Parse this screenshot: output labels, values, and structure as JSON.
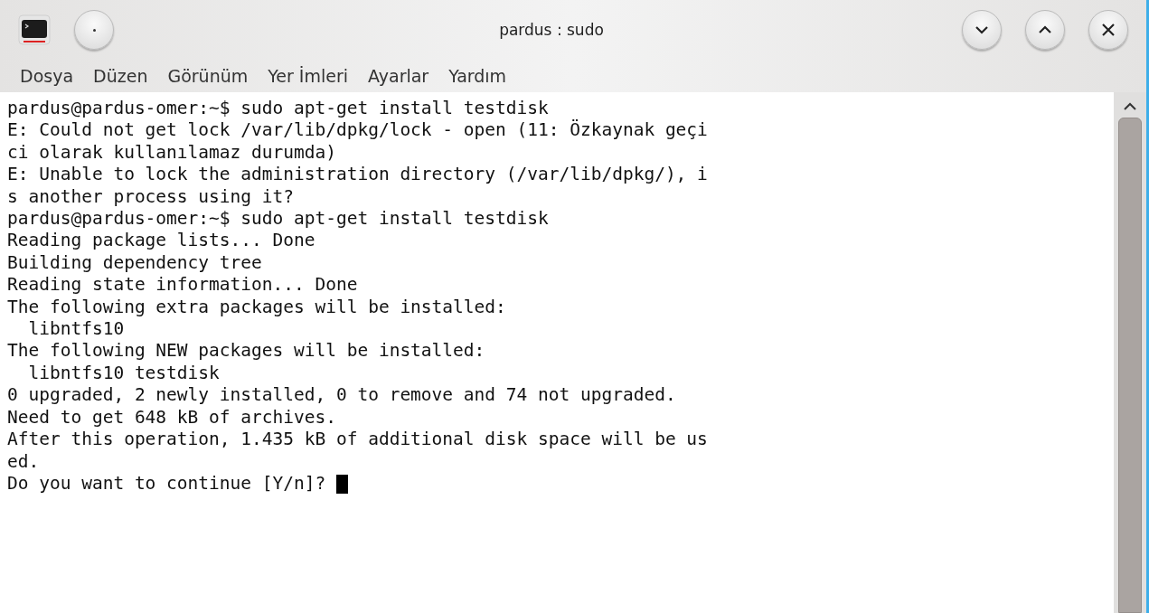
{
  "window": {
    "title": "pardus : sudo"
  },
  "menu": [
    "Dosya",
    "Düzen",
    "Görünüm",
    "Yer İmleri",
    "Ayarlar",
    "Yardım"
  ],
  "terminal": {
    "lines": [
      "pardus@pardus-omer:~$ sudo apt-get install testdisk",
      "E: Could not get lock /var/lib/dpkg/lock - open (11: Özkaynak geçi",
      "ci olarak kullanılamaz durumda)",
      "E: Unable to lock the administration directory (/var/lib/dpkg/), i",
      "s another process using it?",
      "pardus@pardus-omer:~$ sudo apt-get install testdisk",
      "Reading package lists... Done",
      "Building dependency tree",
      "Reading state information... Done",
      "The following extra packages will be installed:",
      "  libntfs10",
      "The following NEW packages will be installed:",
      "  libntfs10 testdisk",
      "0 upgraded, 2 newly installed, 0 to remove and 74 not upgraded.",
      "Need to get 648 kB of archives.",
      "After this operation, 1.435 kB of additional disk space will be us",
      "ed."
    ],
    "prompt": "Do you want to continue [Y/n]? "
  }
}
